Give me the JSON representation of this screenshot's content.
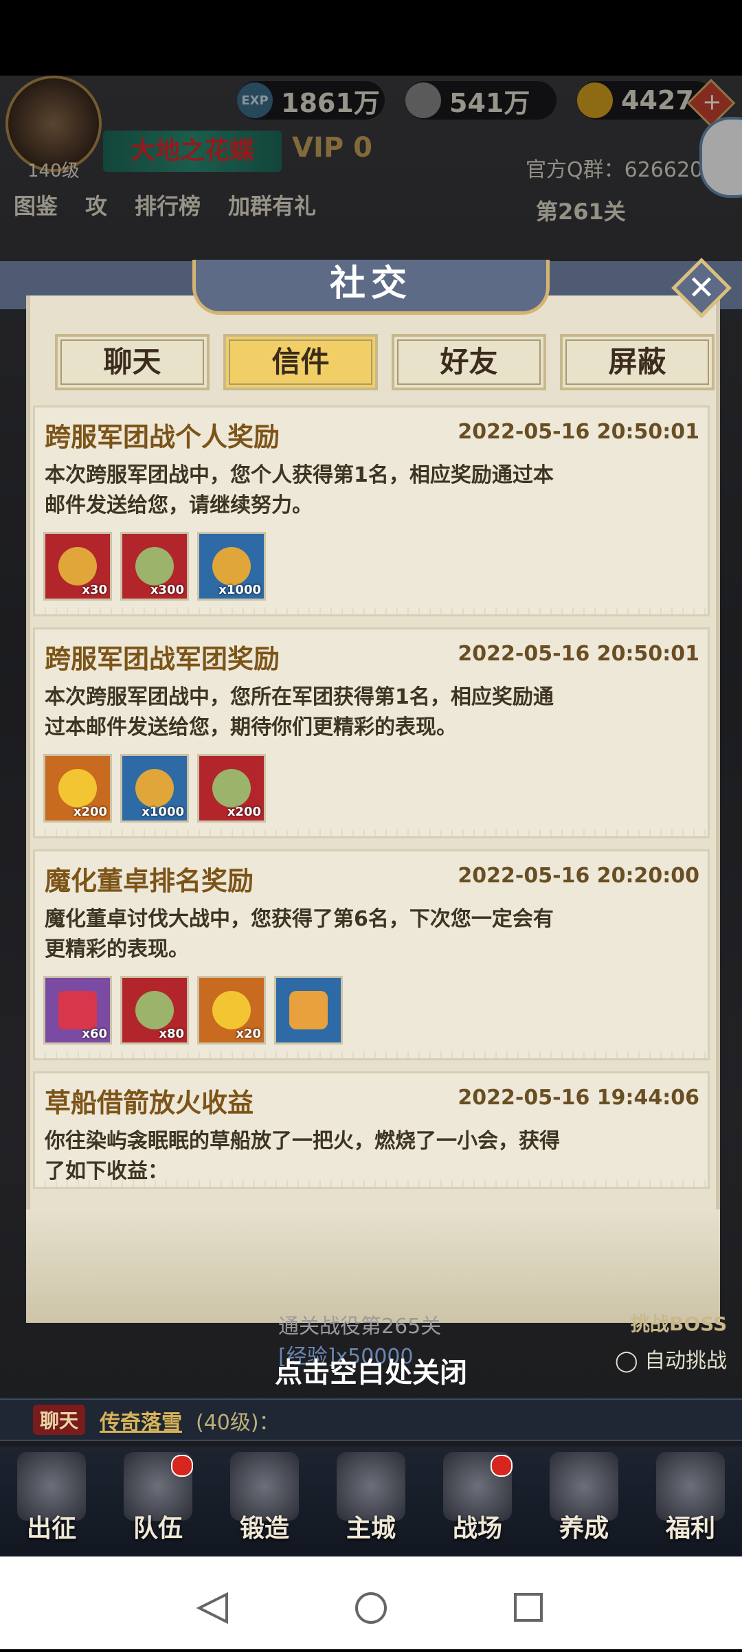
{
  "hud": {
    "player_level": "140级",
    "exp": "1861万",
    "silver": "541万",
    "gold": "4427",
    "exp_icon": "EXP",
    "title_badge": "大地之花蝶",
    "vip": "VIP 0",
    "qq_group": "官方Q群：626620",
    "nav_items": [
      "图鉴",
      "攻",
      "排行榜",
      "加群有礼"
    ],
    "stage": "第261关"
  },
  "modal": {
    "title": "社交",
    "close_icon": "close-icon",
    "tabs": [
      {
        "label": "聊天",
        "active": false
      },
      {
        "label": "信件",
        "active": true
      },
      {
        "label": "好友",
        "active": false
      },
      {
        "label": "屏蔽",
        "active": false
      }
    ],
    "mails": [
      {
        "title": "跨服军团战个人奖励",
        "date": "2022-05-16  20:50:01",
        "body": "本次跨服军团战中，您个人获得第1名，相应奖励通过本邮件发送给您，请继续努力。",
        "items": [
          {
            "icon": "medal-icon",
            "qty": "x30",
            "color": "red"
          },
          {
            "icon": "coin-icon",
            "qty": "x300",
            "color": "red"
          },
          {
            "icon": "token-icon",
            "qty": "x1000",
            "color": "blue"
          }
        ]
      },
      {
        "title": "跨服军团战军团奖励",
        "date": "2022-05-16  20:50:01",
        "body": "本次跨服军团战中，您所在军团获得第1名，相应奖励通过本邮件发送给您，期待你们更精彩的表现。",
        "items": [
          {
            "icon": "gold-ingot-icon",
            "qty": "x200",
            "color": "orange"
          },
          {
            "icon": "token-icon",
            "qty": "x1000",
            "color": "blue"
          },
          {
            "icon": "coin-icon",
            "qty": "x200",
            "color": "red"
          }
        ]
      },
      {
        "title": "魔化董卓排名奖励",
        "date": "2022-05-16  20:20:00",
        "body": "魔化董卓讨伐大战中，您获得了第6名，下次您一定会有更精彩的表现。",
        "items": [
          {
            "icon": "gem-icon",
            "qty": "x60",
            "color": "purple"
          },
          {
            "icon": "coin-icon",
            "qty": "x80",
            "color": "red"
          },
          {
            "icon": "gold-ingot-icon",
            "qty": "x20",
            "color": "orange"
          },
          {
            "icon": "armor-icon",
            "qty": "",
            "color": "blue"
          }
        ]
      },
      {
        "title": "草船借箭放火收益",
        "date": "2022-05-16  19:44:06",
        "body": "你往染屿衾眠眠的草船放了一把火，燃烧了一小会，获得了如下收益：",
        "items": []
      }
    ]
  },
  "bottom": {
    "stage_text": "通关战役第265关",
    "exp_reward": "[经验]x50000",
    "boss_button": "挑战BOSS",
    "auto_button": "自动挑战",
    "close_hint": "点击空白处关闭",
    "chat_tag": "聊天",
    "chat_name": "传奇落雪",
    "chat_level": "(40级)：",
    "tabs": [
      {
        "label": "出征",
        "dot": false
      },
      {
        "label": "队伍",
        "dot": true
      },
      {
        "label": "锻造",
        "dot": false
      },
      {
        "label": "主城",
        "dot": false
      },
      {
        "label": "战场",
        "dot": true
      },
      {
        "label": "养成",
        "dot": false
      },
      {
        "label": "福利",
        "dot": false
      }
    ]
  },
  "system_nav": [
    "back-icon",
    "home-icon",
    "recents-icon"
  ]
}
